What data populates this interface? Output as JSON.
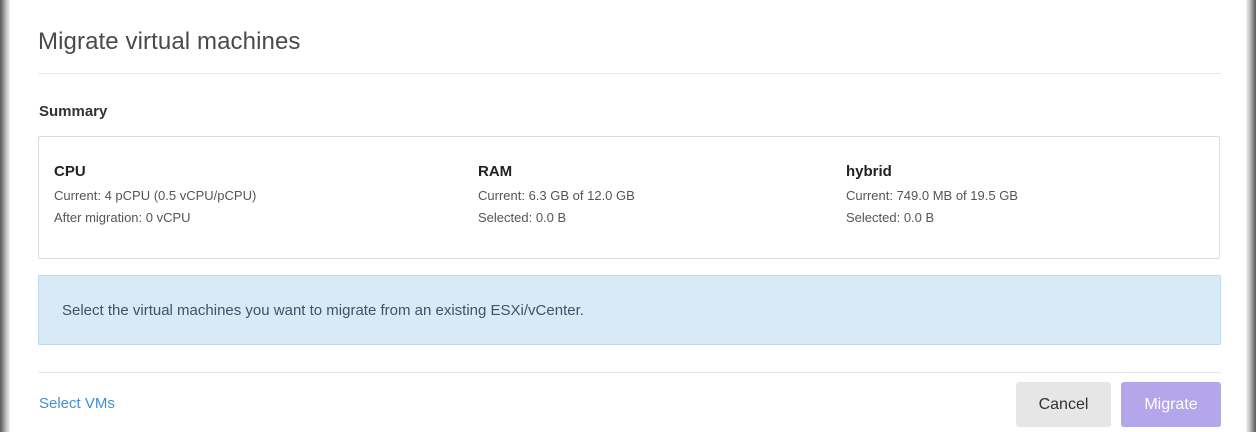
{
  "dialog": {
    "title": "Migrate virtual machines"
  },
  "summary": {
    "label": "Summary",
    "stats": [
      {
        "name": "CPU",
        "lines": [
          "Current: 4 pCPU (0.5 vCPU/pCPU)",
          "After migration: 0 vCPU"
        ]
      },
      {
        "name": "RAM",
        "lines": [
          "Current: 6.3 GB of 12.0 GB",
          "Selected: 0.0 B"
        ]
      },
      {
        "name": "hybrid",
        "lines": [
          "Current: 749.0 MB of 19.5 GB",
          "Selected: 0.0 B"
        ]
      }
    ]
  },
  "info": {
    "text": "Select the virtual machines you want to migrate from an existing ESXi/vCenter."
  },
  "footer": {
    "select_vms_label": "Select VMs",
    "cancel_label": "Cancel",
    "migrate_label": "Migrate"
  },
  "colors": {
    "accent_link": "#3e8fd8",
    "migrate_button": "#b3a6ea",
    "info_background": "#d7eaf6"
  }
}
